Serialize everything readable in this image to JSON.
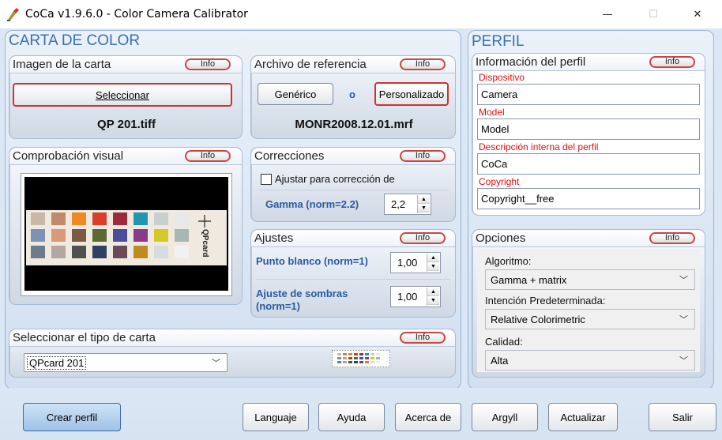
{
  "window": {
    "title": "CoCa v1.9.6.0 - Color Camera Calibrator",
    "min_glyph": "—",
    "max_glyph": "☐",
    "close_glyph": "✕"
  },
  "carta": {
    "title": "CARTA DE COLOR",
    "imagen": {
      "title": "Imagen de la carta",
      "info": "Info",
      "select_button": "Seleccionar",
      "file": "QP 201.tiff"
    },
    "referencia": {
      "title": "Archivo de referencia",
      "info": "Info",
      "generic_button": "Genérico",
      "or": "o",
      "custom_button": "Personalizado",
      "file": "MONR2008.12.01.mrf"
    },
    "visual": {
      "title": "Comprobación visual",
      "info": "Info",
      "card_brand": "QPcard"
    },
    "correcciones": {
      "title": "Correcciones",
      "info": "Info",
      "checkbox_label": "Ajustar para corrección de",
      "gamma_label": "Gamma (norm=2.2)",
      "gamma_value": "2,2"
    },
    "ajustes": {
      "title": "Ajustes",
      "info": "Info",
      "white_label": "Punto blanco (norm=1)",
      "white_value": "1,00",
      "shadow_label_1": "Ajuste de sombras",
      "shadow_label_2": "(norm=1)",
      "shadow_value": "1,00"
    },
    "tipo": {
      "title": "Seleccionar el tipo de carta",
      "info": "Info",
      "selected": "QPcard 201"
    }
  },
  "perfil": {
    "title": "PERFIL",
    "info_group": {
      "title": "Información del perfil",
      "info": "Info",
      "device_label": "Dispositivo",
      "device_value": "Camera",
      "model_label": "Model",
      "model_value": "Model",
      "desc_label": "Descripción interna del perfil",
      "desc_value": "CoCa",
      "copyright_label": "Copyright",
      "copyright_value": "Copyright__free"
    },
    "opciones": {
      "title": "Opciones",
      "info": "Info",
      "algo_label": "Algoritmo:",
      "algo_value": "Gamma + matrix",
      "intent_label": "Intención Predeterminada:",
      "intent_value": "Relative Colorimetric",
      "quality_label": "Calidad:",
      "quality_value": "Alta"
    }
  },
  "bottom": {
    "create": "Crear perfil",
    "language": "Languaje",
    "help": "Ayuda",
    "about": "Acerca de",
    "argyll": "Argyll",
    "update": "Actualizar",
    "exit": "Salir"
  },
  "colors": {
    "accent": "#3a6fb5",
    "label_blue": "#2a5aa0",
    "label_red": "#e01010",
    "info_border": "#cc4444"
  },
  "swatches": {
    "row1": [
      "#c9b8a8",
      "#c08a6a",
      "#ef8a20",
      "#d8402a",
      "#9f2a3a",
      "#1f97b0",
      "#c7d0cf",
      "#e9e9e9"
    ],
    "row2": [
      "#7e92b8",
      "#d89a7a",
      "#7a5a40",
      "#5a6a30",
      "#4a4e9a",
      "#8a3a8a",
      "#d7c82a",
      "#a9b7b3"
    ],
    "row3": [
      "#6c7c8c",
      "#b6a6a0",
      "#505050",
      "#304060",
      "#6a4a5a",
      "#c08a20",
      "#d7dce0",
      "#f1f1f1"
    ]
  }
}
